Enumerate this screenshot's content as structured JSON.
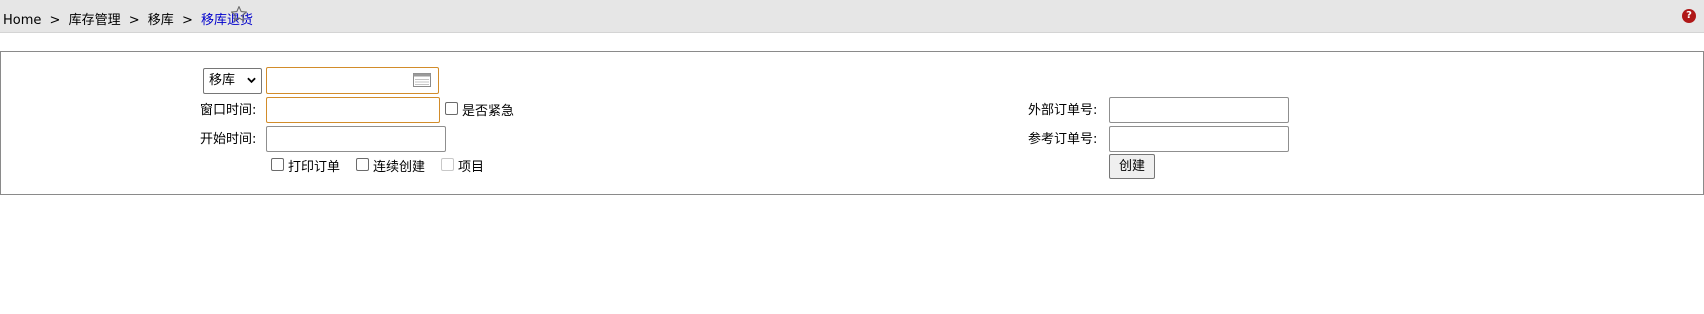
{
  "breadcrumb": {
    "home": "Home",
    "separator": ">",
    "level1": "库存管理",
    "level2": "移库",
    "current": "移库退货"
  },
  "colors": {
    "topbar_bg": "#e6e6e6",
    "current_crumb": "#0000cc",
    "focused_border": "#d28c2a",
    "help_icon": "#b01818"
  },
  "form": {
    "type_select": {
      "value": "移库"
    },
    "date_input": {
      "value": ""
    },
    "window_time": {
      "label": "窗口时间:",
      "value": ""
    },
    "urgent": {
      "label": "是否紧急",
      "checked": false
    },
    "start_time": {
      "label": "开始时间:",
      "value": ""
    },
    "external_order": {
      "label": "外部订单号:",
      "value": ""
    },
    "reference_order": {
      "label": "参考订单号:",
      "value": ""
    },
    "print_order": {
      "label": "打印订单",
      "checked": false
    },
    "continuous_create": {
      "label": "连续创建",
      "checked": false
    },
    "project": {
      "label": "项目",
      "checked": false,
      "disabled": true
    },
    "create_button": "创建"
  },
  "icons": [
    "star-icon",
    "help-icon",
    "calendar-icon",
    "chevron-down-icon"
  ]
}
